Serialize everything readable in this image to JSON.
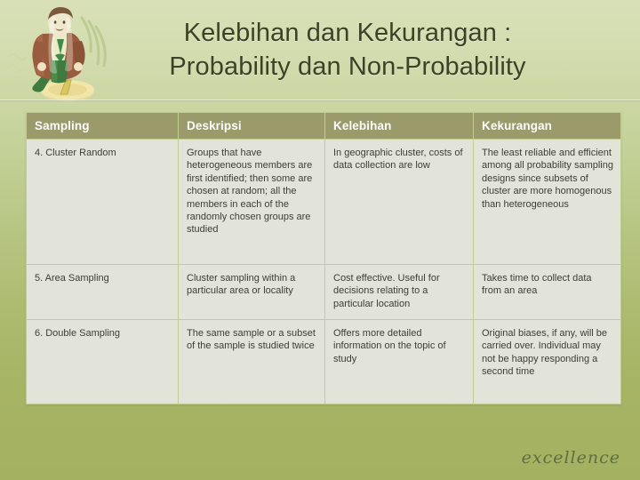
{
  "slide": {
    "title_line1": "Kelebihan dan Kekurangan :",
    "title_line2": "Probability dan Non-Probability",
    "footer_mark": "excellence",
    "clipart_name": "cartoon-man-on-winner-podium"
  },
  "colors": {
    "background_top": "#d9e0b8",
    "background_bottom": "#a3b160",
    "header_fill": "#9a9a6b",
    "header_text": "#ffffff",
    "cell_fill": "#e2e4da",
    "cell_text": "#3d3d35",
    "cell_border": "#c2cc92",
    "title_text": "#3b4226",
    "footer_text": "#55613a"
  },
  "table": {
    "headers": [
      "Sampling",
      "Deskripsi",
      "Kelebihan",
      "Kekurangan"
    ],
    "rows": [
      {
        "sampling": "4. Cluster Random",
        "deskripsi": "Groups that have heterogeneous members are first identified; then some are chosen at random; all the members in each of the randomly chosen groups are studied",
        "kelebihan": "In geographic cluster, costs of data collection are low",
        "kekurangan": "The least reliable and efficient among all probability sampling designs since subsets of cluster are more homogenous than heterogeneous"
      },
      {
        "sampling": "5. Area Sampling",
        "deskripsi": "Cluster sampling within a particular area or locality",
        "kelebihan": "Cost effective. Useful for decisions relating to a particular location",
        "kekurangan": "Takes time to collect data from an area"
      },
      {
        "sampling": "6. Double Sampling",
        "deskripsi": "The same sample or a subset of the sample is studied twice",
        "kelebihan": "Offers more detailed information on the topic of study",
        "kekurangan": "Original biases, if any, will be carried over. Individual may not be happy responding a second time"
      }
    ]
  }
}
